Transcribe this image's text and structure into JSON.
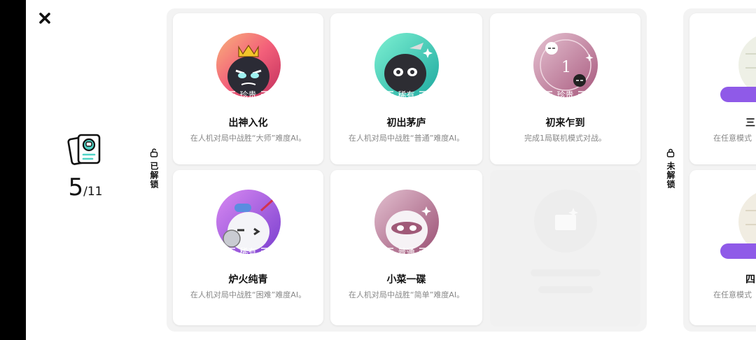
{
  "progress": {
    "unlocked_count": "5",
    "total_label": "/11"
  },
  "sections": {
    "unlocked_label": "已解锁",
    "locked_label": "未解锁"
  },
  "unlocked_cards": [
    {
      "title": "出神入化",
      "desc": "在人机对局中战胜“大师”难度AI。",
      "rarity": "珍贵",
      "badge_color": "#8f5ae8"
    },
    {
      "title": "初出茅庐",
      "desc": "在人机对局中战胜“普通”难度AI。",
      "rarity": "稀有",
      "badge_color": "#4f9af2"
    },
    {
      "title": "初来乍到",
      "desc": "完成1局联机模式对战。",
      "rarity": "珍贵",
      "badge_color": "#8f5ae8"
    },
    {
      "title": "炉火纯青",
      "desc": "在人机对局中战胜“困难”难度AI。",
      "rarity": "稀有",
      "badge_color": "#4f9af2"
    },
    {
      "title": "小菜一碟",
      "desc": "在人机对局中战胜“简单”难度AI。",
      "rarity": "普通",
      "badge_color": "#9ba3ab"
    }
  ],
  "locked_cards": [
    {
      "title": "三",
      "desc": "在任意模式"
    },
    {
      "title": "四",
      "desc": "在任意模式"
    }
  ],
  "icons": {
    "close": "close-icon",
    "lock": "lock-icon",
    "unlock": "unlock-icon",
    "collection": "card-collection-icon"
  }
}
